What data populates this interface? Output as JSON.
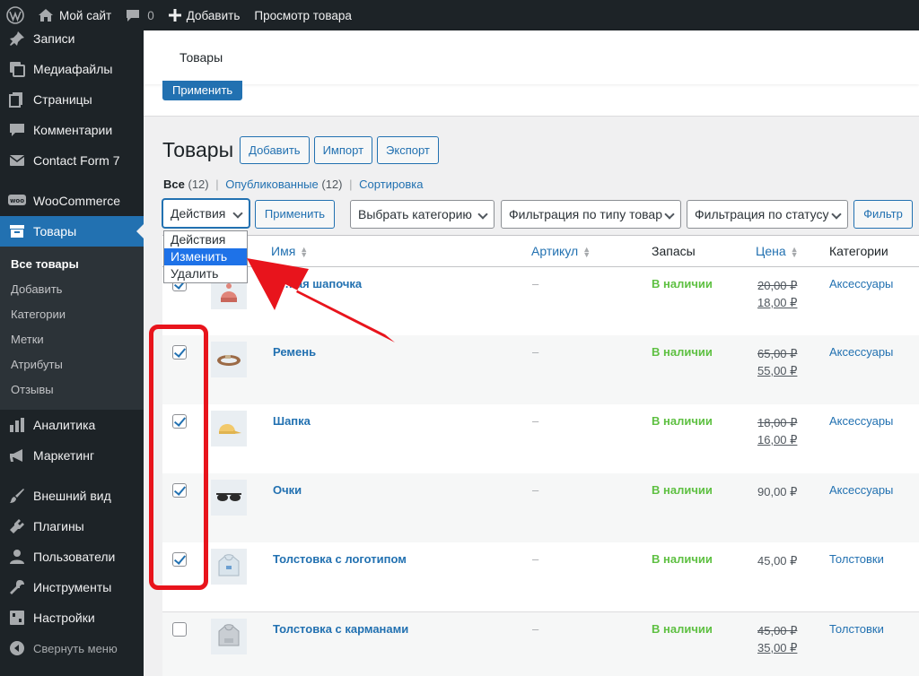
{
  "adminbar": {
    "site_name": "Мой сайт",
    "comments_count": "0",
    "add_label": "Добавить",
    "view_label": "Просмотр товара"
  },
  "sidebar": {
    "items": [
      {
        "label": "Записи",
        "icon": "pin-icon"
      },
      {
        "label": "Медиафайлы",
        "icon": "media-icon"
      },
      {
        "label": "Страницы",
        "icon": "pages-icon"
      },
      {
        "label": "Комментарии",
        "icon": "comment-icon"
      },
      {
        "label": "Contact Form 7",
        "icon": "mail-icon"
      },
      {
        "label": "WooCommerce",
        "icon": "woo-icon"
      },
      {
        "label": "Товары",
        "icon": "archive-icon"
      },
      {
        "label": "Аналитика",
        "icon": "chart-icon"
      },
      {
        "label": "Маркетинг",
        "icon": "megaphone-icon"
      },
      {
        "label": "Внешний вид",
        "icon": "brush-icon"
      },
      {
        "label": "Плагины",
        "icon": "plugin-icon"
      },
      {
        "label": "Пользователи",
        "icon": "user-icon"
      },
      {
        "label": "Инструменты",
        "icon": "wrench-icon"
      },
      {
        "label": "Настройки",
        "icon": "settings-icon"
      }
    ],
    "submenu": [
      "Все товары",
      "Добавить",
      "Категории",
      "Метки",
      "Атрибуты",
      "Отзывы"
    ],
    "collapse_label": "Свернуть меню"
  },
  "header": {
    "breadcrumb": "Товары",
    "apply_top": "Применить"
  },
  "page": {
    "title": "Товары",
    "add_button": "Добавить",
    "import_button": "Импорт",
    "export_button": "Экспорт"
  },
  "views": {
    "all": "Все",
    "all_count": "(12)",
    "published": "Опубликованные",
    "published_count": "(12)",
    "sorting": "Сортировка",
    "separator": "|"
  },
  "tablenav": {
    "bulk_selected": "Действия",
    "apply": "Применить",
    "category_filter": "Выбрать категорию",
    "type_filter": "Фильтрация по типу товар",
    "status_filter": "Фильтрация по статусу",
    "filter_button": "Фильтр"
  },
  "bulk_dropdown": {
    "options": [
      "Действия",
      "Изменить",
      "Удалить"
    ],
    "highlighted": "Изменить"
  },
  "table": {
    "columns": {
      "name": "Имя",
      "sku": "Артикул",
      "stock": "Запасы",
      "price": "Цена",
      "categories": "Категории"
    },
    "rows": [
      {
        "name": "…ная шапочка",
        "sku": "–",
        "stock": "В наличии",
        "old_price": "20,00 ₽",
        "price": "18,00 ₽",
        "category": "Аксессуары",
        "checked": true
      },
      {
        "name": "Ремень",
        "sku": "–",
        "stock": "В наличии",
        "old_price": "65,00 ₽",
        "price": "55,00 ₽",
        "category": "Аксессуары",
        "checked": true
      },
      {
        "name": "Шапка",
        "sku": "–",
        "stock": "В наличии",
        "old_price": "18,00 ₽",
        "price": "16,00 ₽",
        "category": "Аксессуары",
        "checked": true
      },
      {
        "name": "Очки",
        "sku": "–",
        "stock": "В наличии",
        "old_price": "",
        "price": "90,00 ₽",
        "category": "Аксессуары",
        "checked": true
      },
      {
        "name": "Толстовка с логотипом",
        "sku": "–",
        "stock": "В наличии",
        "old_price": "",
        "price": "45,00 ₽",
        "category": "Толстовки",
        "checked": true
      },
      {
        "name": "Толстовка с карманами",
        "sku": "–",
        "stock": "В наличии",
        "old_price": "45,00 ₽",
        "price": "35,00 ₽",
        "category": "Толстовки",
        "checked": false
      }
    ]
  },
  "colors": {
    "accent": "#2271b1",
    "stock_green": "#5ec042",
    "annotation_red": "#e8141c"
  }
}
